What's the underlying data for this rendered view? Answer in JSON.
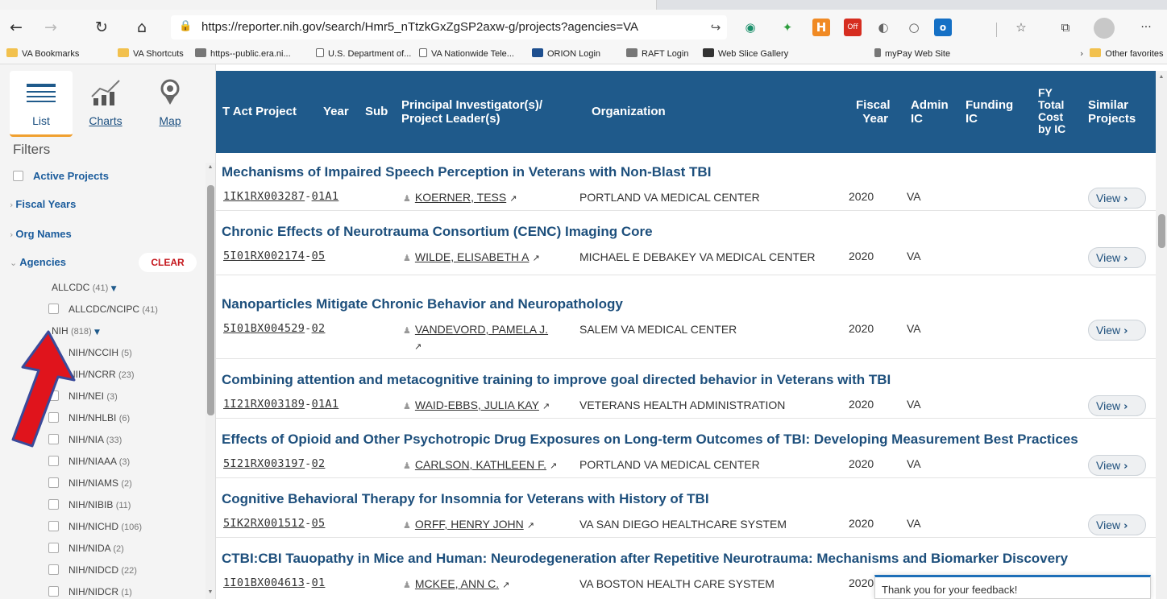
{
  "browser": {
    "url": "https://reporter.nih.gov/search/Hmr5_nTtzkGxZgSP2axw-g/projects?agencies=VA",
    "extensions": [
      "reading-view-icon",
      "globe-icon",
      "flame-icon",
      "honey-icon",
      "ad-off-icon",
      "circle-icon",
      "ring-icon",
      "outlook-icon",
      "favorites-icon",
      "collections-icon"
    ],
    "menu_glyph": "···"
  },
  "bookmarks": [
    {
      "label": "VA Bookmarks",
      "icon": "folder"
    },
    {
      "label": "VA Shortcuts",
      "icon": "folder"
    },
    {
      "label": "https--public.era.ni...",
      "icon": "gray"
    },
    {
      "label": "U.S. Department of...",
      "icon": "page"
    },
    {
      "label": "VA Nationwide Tele...",
      "icon": "page"
    },
    {
      "label": "ORION Login",
      "icon": "blue"
    },
    {
      "label": "RAFT Login",
      "icon": "gray"
    },
    {
      "label": "Web Slice Gallery",
      "icon": "dark"
    },
    {
      "label": "myPay Web Site",
      "icon": "gray"
    }
  ],
  "other_favorites": "Other favorites",
  "view_tabs": {
    "list": "List",
    "charts": "Charts",
    "map": "Map"
  },
  "filters": {
    "heading": "Filters",
    "active_projects": "Active Projects",
    "fiscal_years": "Fiscal Years",
    "org_names": "Org Names",
    "agencies": "Agencies",
    "clear": "CLEAR",
    "groups": [
      {
        "label": "ALLCDC",
        "count": "(41)"
      },
      {
        "label": "ALLCDC/NCIPC",
        "count": "(41)"
      },
      {
        "label": "NIH",
        "count": "(818)"
      },
      {
        "label": "NIH/NCCIH",
        "count": "(5)"
      },
      {
        "label": "NIH/NCRR",
        "count": "(23)"
      },
      {
        "label": "NIH/NEI",
        "count": "(3)"
      },
      {
        "label": "NIH/NHLBI",
        "count": "(6)"
      },
      {
        "label": "NIH/NIA",
        "count": "(33)"
      },
      {
        "label": "NIH/NIAAA",
        "count": "(3)"
      },
      {
        "label": "NIH/NIAMS",
        "count": "(2)"
      },
      {
        "label": "NIH/NIBIB",
        "count": "(11)"
      },
      {
        "label": "NIH/NICHD",
        "count": "(106)"
      },
      {
        "label": "NIH/NIDA",
        "count": "(2)"
      },
      {
        "label": "NIH/NIDCD",
        "count": "(22)"
      },
      {
        "label": "NIH/NIDCR",
        "count": "(1)"
      }
    ]
  },
  "table": {
    "headers": {
      "t_act_project": "T Act Project",
      "year": "Year",
      "sub": "Sub",
      "pi_line1": "Principal Investigator(s)/",
      "pi_line2": "Project Leader(s)",
      "organization": "Organization",
      "fiscal_1": "Fiscal",
      "fiscal_2": "Year",
      "admin_1": "Admin",
      "admin_2": "IC",
      "funding_1": "Funding",
      "funding_2": "IC",
      "fy_1": "FY",
      "fy_2": "Total",
      "fy_3": "Cost",
      "fy_4": "by IC",
      "similar_1": "Similar",
      "similar_2": "Projects"
    },
    "view_label": "View",
    "rows": [
      {
        "title": "Mechanisms of Impaired Speech Perception in Veterans with Non-Blast TBI",
        "type_act": "1IK1",
        "serial": "RX003287",
        "suffix": "01A1",
        "pi": "KOERNER, TESS",
        "org": "PORTLAND VA MEDICAL CENTER",
        "fiscal_year": "2020",
        "admin_ic": "VA"
      },
      {
        "title": "Chronic Effects of Neurotrauma Consortium (CENC) Imaging Core",
        "type_act": "5I01",
        "serial": "RX002174",
        "suffix": "05",
        "pi": "WILDE, ELISABETH A",
        "org": "MICHAEL E DEBAKEY VA MEDICAL CENTER",
        "fiscal_year": "2020",
        "admin_ic": "VA"
      },
      {
        "title": "Nanoparticles Mitigate Chronic Behavior and Neuropathology",
        "type_act": "5I01",
        "serial": "BX004529",
        "suffix": "02",
        "pi": "VANDEVORD, PAMELA J.",
        "org": "SALEM VA MEDICAL CENTER",
        "fiscal_year": "2020",
        "admin_ic": "VA"
      },
      {
        "title": "Combining attention and metacognitive training to improve goal directed behavior in Veterans with TBI",
        "type_act": "1I21",
        "serial": "RX003189",
        "suffix": "01A1",
        "pi": "WAID-EBBS, JULIA KAY",
        "org": "VETERANS HEALTH ADMINISTRATION",
        "fiscal_year": "2020",
        "admin_ic": "VA"
      },
      {
        "title": "Effects of Opioid and Other Psychotropic Drug Exposures on Long-term Outcomes of TBI: Developing Measurement Best Practices",
        "type_act": "5I21",
        "serial": "RX003197",
        "suffix": "02",
        "pi": "CARLSON, KATHLEEN F.",
        "org": "PORTLAND VA MEDICAL CENTER",
        "fiscal_year": "2020",
        "admin_ic": "VA"
      },
      {
        "title": "Cognitive Behavioral Therapy for Insomnia for Veterans with History of TBI",
        "type_act": "5IK2",
        "serial": "RX001512",
        "suffix": "05",
        "pi": "ORFF, HENRY JOHN",
        "org": "VA SAN DIEGO HEALTHCARE SYSTEM",
        "fiscal_year": "2020",
        "admin_ic": "VA"
      },
      {
        "title": "CTBI:CBI Tauopathy in Mice and Human: Neurodegeneration after Repetitive Neurotrauma: Mechanisms and Biomarker Discovery",
        "type_act": "1I01",
        "serial": "BX004613",
        "suffix": "01",
        "pi": "MCKEE, ANN C.",
        "org": "VA BOSTON HEALTH CARE SYSTEM",
        "fiscal_year": "2020",
        "admin_ic": ""
      }
    ]
  },
  "toast": "Thank you for your feedback!",
  "colors": {
    "header": "#1f5a8b",
    "title": "#1d4f7c",
    "accent": "#f0a030",
    "clear": "#c4161c"
  }
}
